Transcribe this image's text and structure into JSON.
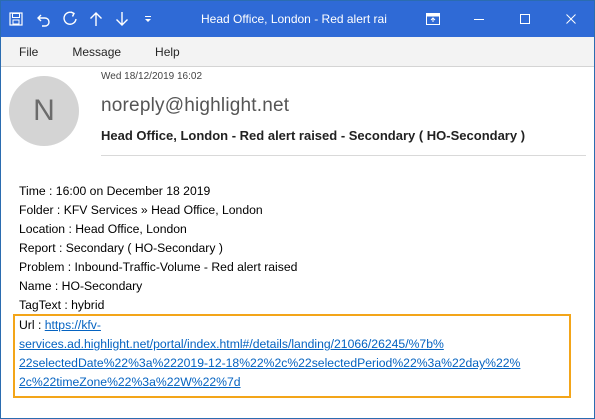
{
  "window": {
    "title": "Head Office, London - Red alert raised",
    "controls": [
      "restore-ribbon",
      "minimize",
      "maximize",
      "close"
    ]
  },
  "toolbar": {
    "icons": [
      "save-icon",
      "undo-icon",
      "redo-icon",
      "up-arrow-icon",
      "down-arrow-icon",
      "customize-icon"
    ]
  },
  "menu": {
    "items": [
      "File",
      "Message",
      "Help"
    ]
  },
  "message": {
    "avatar_initial": "N",
    "date": "Wed 18/12/2019 16:02",
    "sender": "noreply@highlight.net",
    "subject": "Head Office, London - Red alert raised - Secondary ( HO-Secondary )"
  },
  "body": {
    "lines": [
      "Time : 16:00 on December 18 2019",
      "Folder : KFV Services » Head Office, London",
      "Location : Head Office, London",
      "Report : Secondary ( HO-Secondary )",
      "Problem : Inbound-Traffic-Volume - Red alert raised",
      "Name : HO-Secondary",
      "TagText : hybrid"
    ],
    "url_label": "Url : ",
    "url_lines": [
      "https://kfv-",
      "services.ad.highlight.net/portal/index.html#/details/landing/21066/26245/%7b%",
      "22selectedDate%22%3a%222019-12-18%22%2c%22selectedPeriod%22%3a%22day%22%",
      "2c%22timeZone%22%3a%22W%22%7d"
    ]
  },
  "colors": {
    "titlebar": "#2f6ad6",
    "highlight_box": "#f3a519",
    "link": "#0563c1"
  }
}
